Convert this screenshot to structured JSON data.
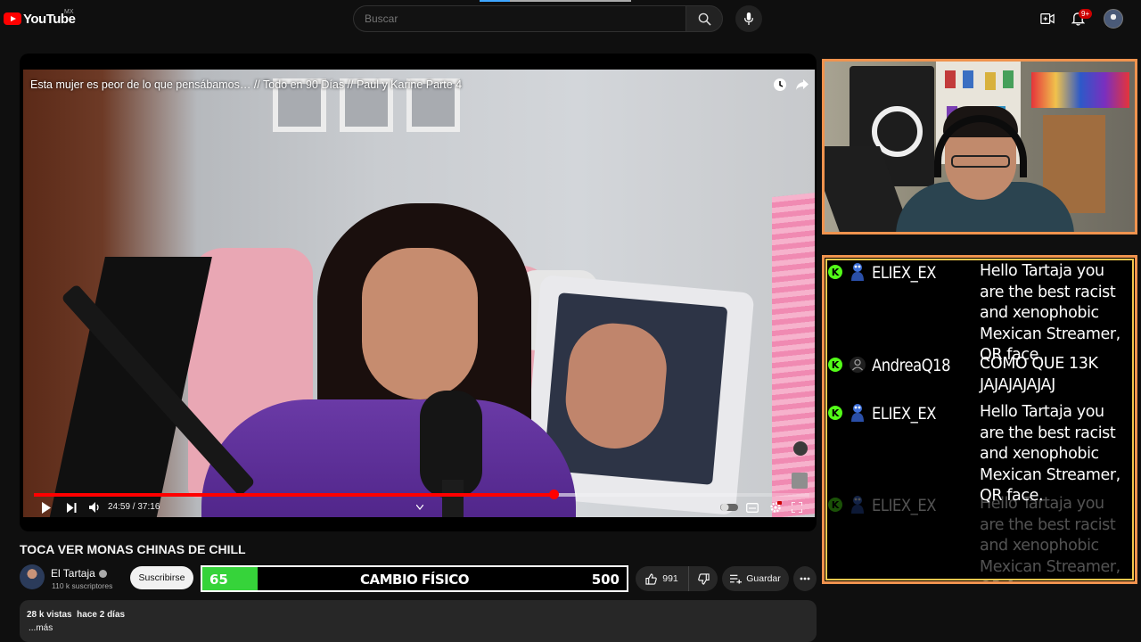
{
  "topbar": {
    "logo_text": "YouTube",
    "logo_country": "MX",
    "search_placeholder": "Buscar",
    "notification_count": "9+"
  },
  "player": {
    "video_title_overlay": "Esta mujer es peor de lo que pensábamos… // Todo en 90 Días // Paul y Karine Parte 4",
    "time_display": "24:59 / 37:16",
    "progress_played_fraction": 0.67,
    "progress_buffered_fraction": 0.7
  },
  "video": {
    "heading": "TOCA VER MONAS CHINAS DE CHILL",
    "channel_name": "El Tartaja",
    "subscribers": "110 k suscriptores",
    "subscribe_label": "Suscribirse",
    "like_count": "991",
    "save_label": "Guardar",
    "views_date": "28 k vistas  hace 2 días",
    "more_label": "...más"
  },
  "goal": {
    "current": "65",
    "label": "CAMBIO FÍSICO",
    "target": "500",
    "fill_fraction": 0.13,
    "color": "#36d33a"
  },
  "chat": {
    "messages": [
      {
        "user": "ELIEX_EX",
        "text": "Hello Tartaja you are the best racist and xenophobic Mexican Streamer, QR face.",
        "avatar": "blue-gif-avatar"
      },
      {
        "user": "AndreaQ18",
        "text": "COMO QUE 13K JAJAJAJAJAJ",
        "avatar": "default-user-icon"
      },
      {
        "user": "ELIEX_EX",
        "text": "Hello Tartaja you are the best racist and xenophobic Mexican Streamer, QR face.",
        "avatar": "blue-gif-avatar"
      },
      {
        "user": "ELIEX_EX",
        "text": "Hello Tartaja you are the best racist and xenophobic Mexican Streamer, QR face.",
        "avatar": "blue-gif-avatar"
      }
    ],
    "platform_icon_color": "#53fc18",
    "border_color": "#f0934e",
    "inner_border_color": "#f4c84d"
  },
  "colors": {
    "accent_red": "#ff0000",
    "background": "#0f0f0f"
  }
}
